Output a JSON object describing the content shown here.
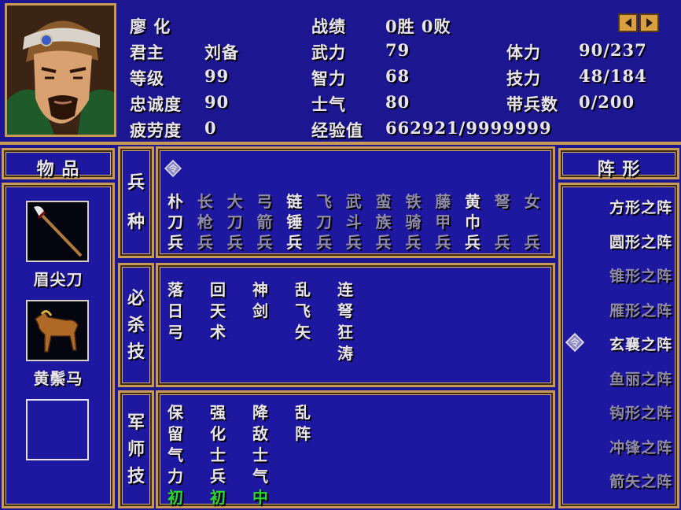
{
  "general": {
    "name": "廖 化",
    "lord_label": "君主",
    "lord": "刘备",
    "level_label": "等级",
    "level": "99",
    "loyalty_label": "忠诚度",
    "loyalty": "90",
    "fatigue_label": "疲劳度",
    "fatigue": "0",
    "record_label": "战绩",
    "record": "0胜 0败",
    "force_label": "武力",
    "force": "79",
    "intel_label": "智力",
    "intel": "68",
    "morale_label": "士气",
    "morale": "80",
    "exp_label": "经验值",
    "exp": "662921/9999999",
    "hp_label": "体力",
    "hp": "90/237",
    "skill_label": "技力",
    "skill": "48/184",
    "troops_label": "带兵数",
    "troops": "0/200"
  },
  "items": {
    "header": "物 品",
    "list": [
      {
        "name": "眉尖刀",
        "icon": "glaive-icon"
      },
      {
        "name": "黄鬃马",
        "icon": "horse-icon"
      },
      {
        "name": "",
        "icon": "empty-slot"
      }
    ]
  },
  "troop_types": {
    "label": [
      "兵",
      "种"
    ],
    "columns": [
      {
        "chars": [
          "朴",
          "刀",
          "兵"
        ],
        "active": true
      },
      {
        "chars": [
          "长",
          "枪",
          "兵"
        ],
        "active": false
      },
      {
        "chars": [
          "大",
          "刀",
          "兵"
        ],
        "active": false
      },
      {
        "chars": [
          "弓",
          "箭",
          "兵"
        ],
        "active": false
      },
      {
        "chars": [
          "链",
          "锤",
          "兵"
        ],
        "active": true
      },
      {
        "chars": [
          "飞",
          "刀",
          "兵"
        ],
        "active": false
      },
      {
        "chars": [
          "武",
          "斗",
          "兵"
        ],
        "active": false
      },
      {
        "chars": [
          "蛮",
          "族",
          "兵"
        ],
        "active": false
      },
      {
        "chars": [
          "铁",
          "骑",
          "兵"
        ],
        "active": false
      },
      {
        "chars": [
          "藤",
          "甲",
          "兵"
        ],
        "active": false
      },
      {
        "chars": [
          "黄",
          "巾",
          "兵"
        ],
        "active": true
      },
      {
        "chars": [
          "弩",
          "",
          "兵"
        ],
        "active": false
      },
      {
        "chars": [
          "女",
          "",
          "兵"
        ],
        "active": false
      }
    ]
  },
  "special_skills": {
    "label": [
      "必",
      "杀",
      "技"
    ],
    "columns": [
      {
        "chars": [
          "落",
          "日",
          "弓"
        ]
      },
      {
        "chars": [
          "回",
          "天",
          "术"
        ]
      },
      {
        "chars": [
          "神",
          "剑"
        ]
      },
      {
        "chars": [
          "乱",
          "飞",
          "矢"
        ]
      },
      {
        "chars": [
          "连",
          "弩",
          "狂",
          "涛"
        ]
      }
    ]
  },
  "strategist_skills": {
    "label": [
      "军",
      "师",
      "技"
    ],
    "columns": [
      {
        "chars": [
          "保",
          "留",
          "气",
          "力"
        ],
        "level": "初"
      },
      {
        "chars": [
          "强",
          "化",
          "士",
          "兵"
        ],
        "level": "初"
      },
      {
        "chars": [
          "降",
          "敌",
          "士",
          "气"
        ],
        "level": "中"
      },
      {
        "chars": [
          "乱",
          "阵"
        ],
        "level": ""
      }
    ]
  },
  "formations": {
    "header": "阵 形",
    "list": [
      {
        "name": "方形之阵",
        "active": true,
        "selected": false
      },
      {
        "name": "圆形之阵",
        "active": true,
        "selected": false
      },
      {
        "name": "锥形之阵",
        "active": false,
        "selected": false
      },
      {
        "name": "雁形之阵",
        "active": false,
        "selected": false
      },
      {
        "name": "玄襄之阵",
        "active": true,
        "selected": true
      },
      {
        "name": "鱼丽之阵",
        "active": false,
        "selected": false
      },
      {
        "name": "钩形之阵",
        "active": false,
        "selected": false
      },
      {
        "name": "冲锋之阵",
        "active": false,
        "selected": false
      },
      {
        "name": "箭矢之阵",
        "active": false,
        "selected": false
      }
    ]
  },
  "colors": {
    "panel": "#1e18a0",
    "border": "#c99a55",
    "active_text": "#e8e4ec",
    "inactive_text": "#8e8aa8",
    "level_text": "#2ad82a"
  }
}
